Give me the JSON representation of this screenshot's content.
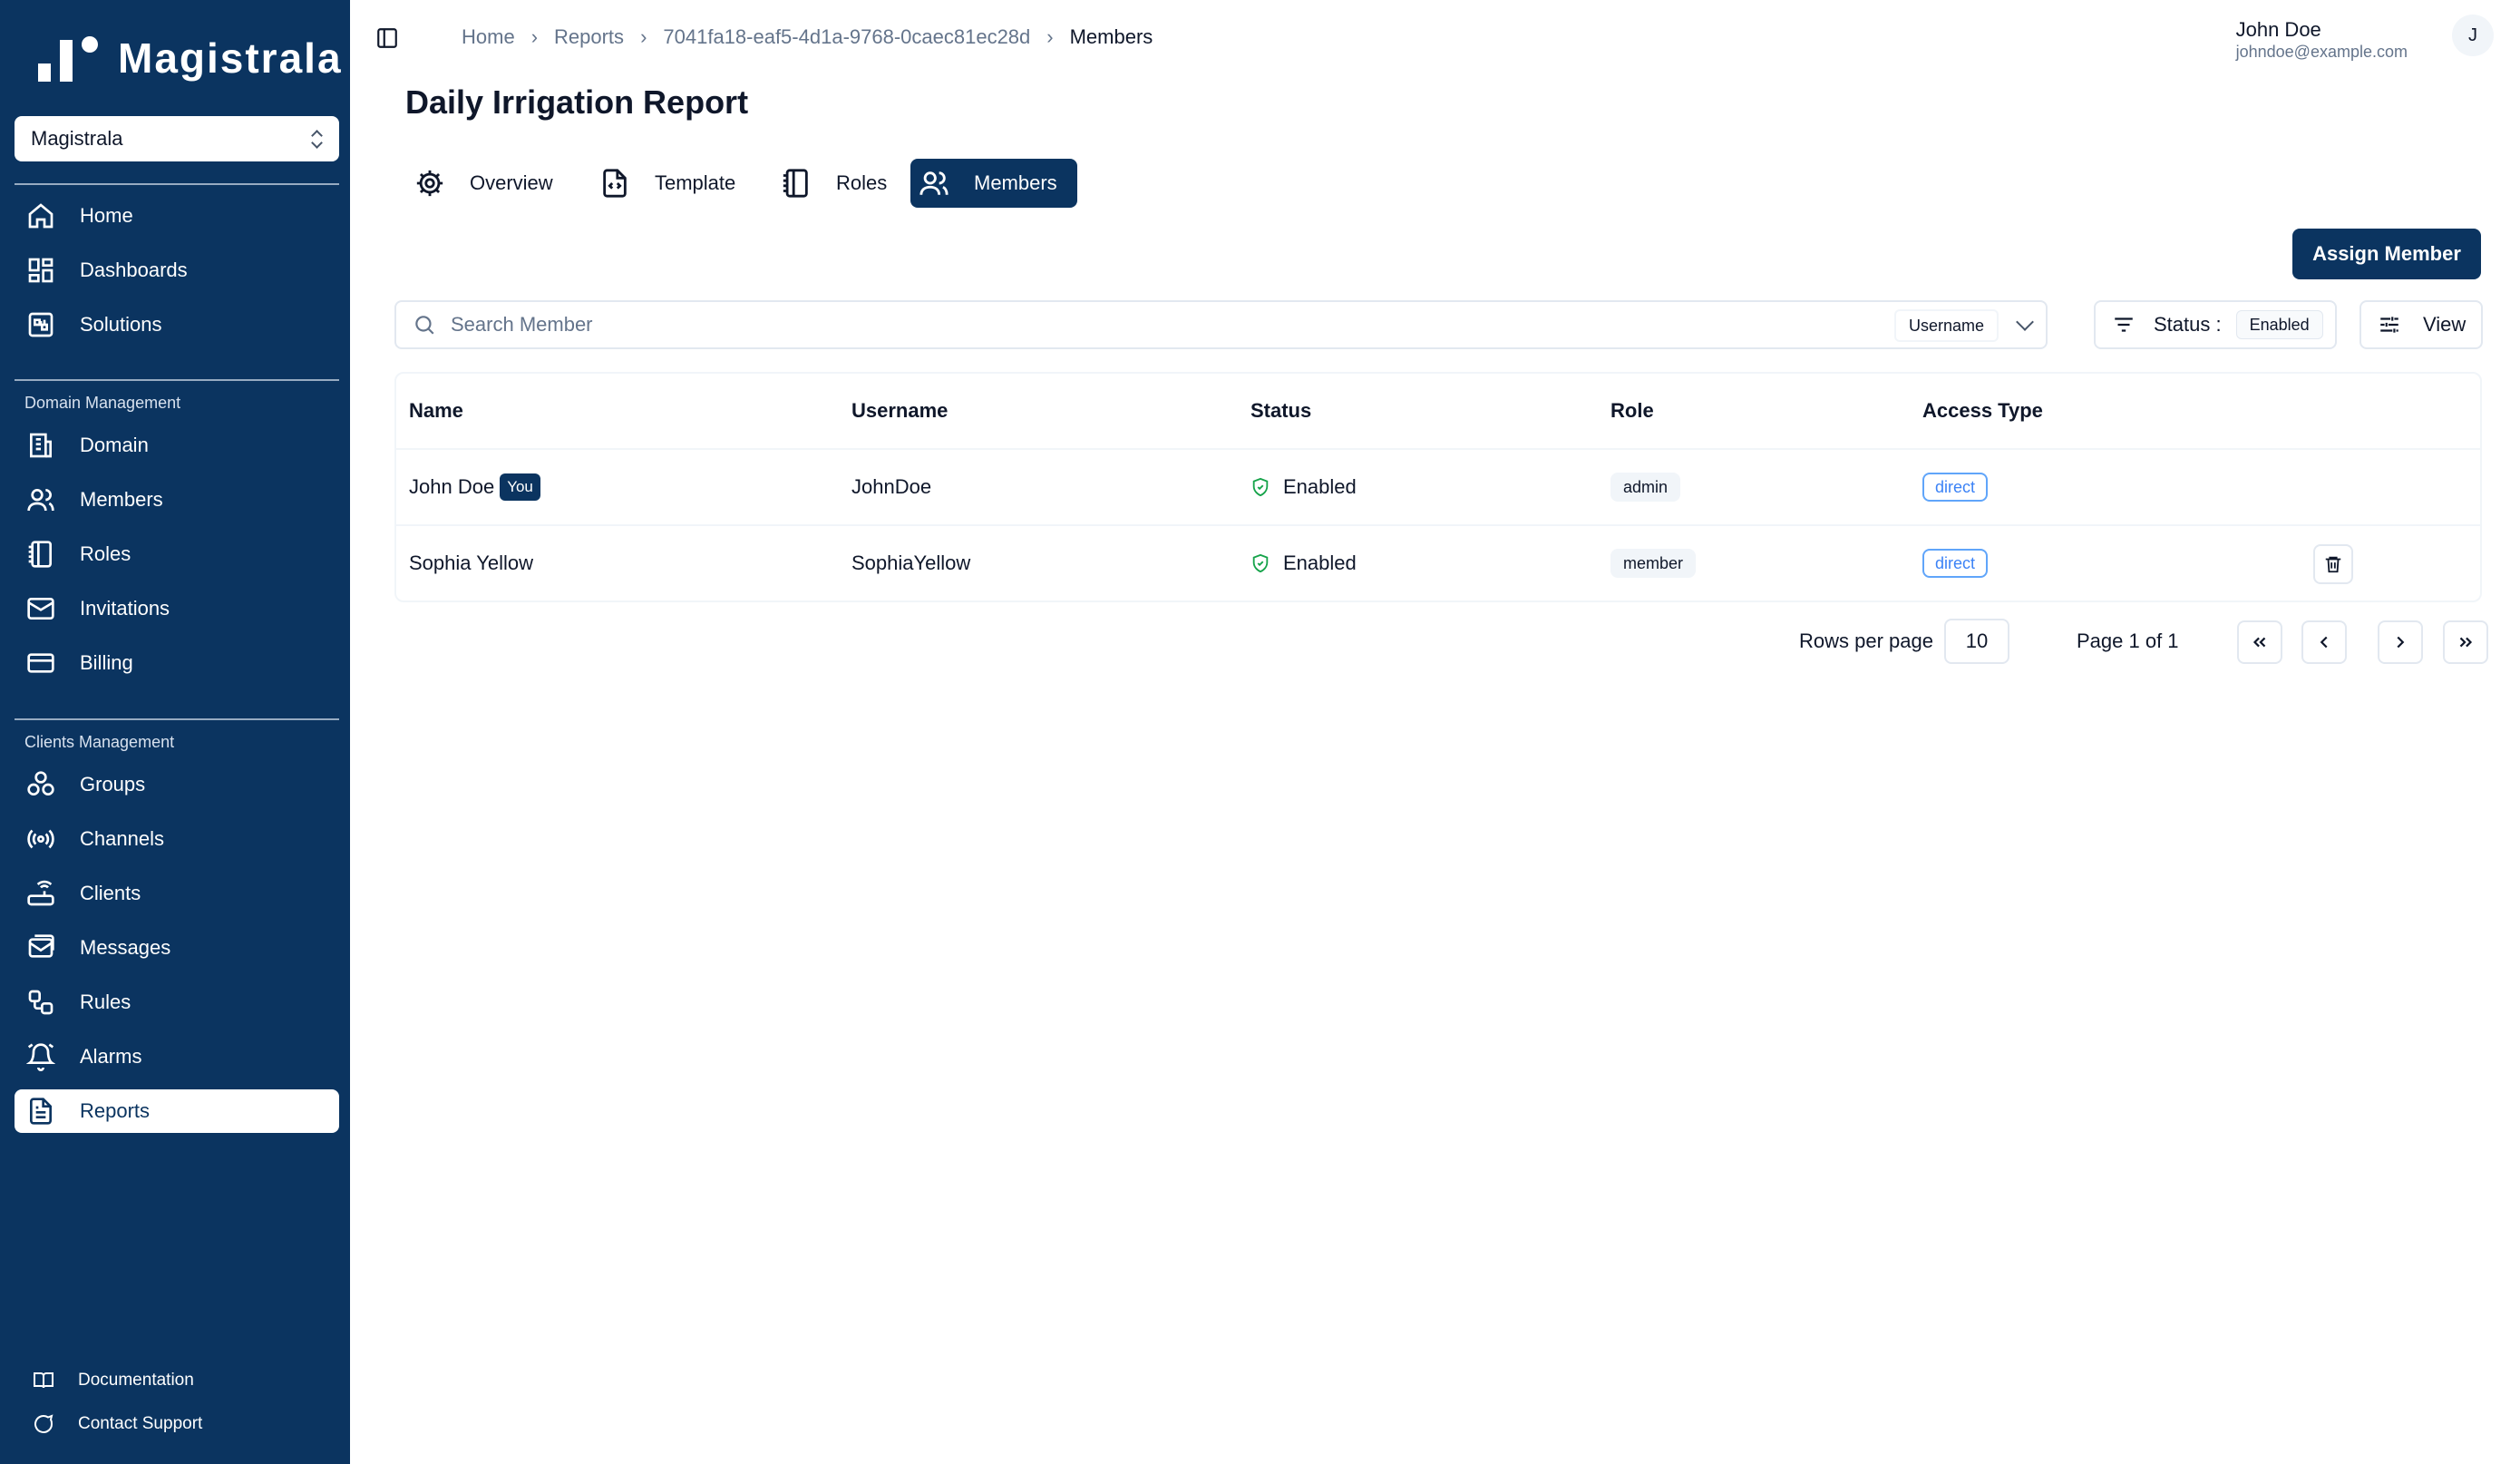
{
  "app": {
    "brand": "Magistrala"
  },
  "workspace": {
    "selected": "Magistrala"
  },
  "sidebar": {
    "main": [
      {
        "label": "Home",
        "icon": "home-icon"
      },
      {
        "label": "Dashboards",
        "icon": "dashboard-icon"
      },
      {
        "label": "Solutions",
        "icon": "solutions-icon"
      }
    ],
    "domain_section": "Domain Management",
    "domain": [
      {
        "label": "Domain",
        "icon": "building-icon"
      },
      {
        "label": "Members",
        "icon": "users-icon"
      },
      {
        "label": "Roles",
        "icon": "notebook-icon"
      },
      {
        "label": "Invitations",
        "icon": "mail-icon"
      },
      {
        "label": "Billing",
        "icon": "credit-card-icon"
      }
    ],
    "clients_section": "Clients Management",
    "clients": [
      {
        "label": "Groups",
        "icon": "groups-icon"
      },
      {
        "label": "Channels",
        "icon": "radio-icon"
      },
      {
        "label": "Clients",
        "icon": "router-icon"
      },
      {
        "label": "Messages",
        "icon": "messages-icon"
      },
      {
        "label": "Rules",
        "icon": "workflow-icon"
      },
      {
        "label": "Alarms",
        "icon": "bell-icon"
      },
      {
        "label": "Reports",
        "icon": "file-text-icon"
      }
    ],
    "footer": [
      {
        "label": "Documentation",
        "icon": "book-icon"
      },
      {
        "label": "Contact Support",
        "icon": "chat-icon"
      }
    ]
  },
  "breadcrumb": [
    "Home",
    "Reports",
    "7041fa18-eaf5-4d1a-9768-0caec81ec28d",
    "Members"
  ],
  "user": {
    "name": "John Doe",
    "email": "johndoe@example.com",
    "initial": "J"
  },
  "page": {
    "title": "Daily Irrigation Report"
  },
  "tabs": [
    {
      "label": "Overview",
      "icon": "gear-icon"
    },
    {
      "label": "Template",
      "icon": "file-code-icon"
    },
    {
      "label": "Roles",
      "icon": "notebook-icon"
    },
    {
      "label": "Members",
      "icon": "users-icon"
    }
  ],
  "actions": {
    "assign": "Assign Member"
  },
  "search": {
    "placeholder": "Search Member",
    "field": "Username"
  },
  "filter": {
    "label": "Status :",
    "value": "Enabled"
  },
  "view": {
    "label": "View"
  },
  "table": {
    "headers": [
      "Name",
      "Username",
      "Status",
      "Role",
      "Access Type"
    ],
    "rows": [
      {
        "name": "John Doe",
        "badge": "You",
        "username": "JohnDoe",
        "status": "Enabled",
        "role": "admin",
        "access": "direct"
      },
      {
        "name": "Sophia Yellow",
        "username": "SophiaYellow",
        "status": "Enabled",
        "role": "member",
        "access": "direct"
      }
    ]
  },
  "pagination": {
    "rows_label": "Rows per page",
    "rows_value": "10",
    "page_info": "Page 1 of 1"
  },
  "colors": {
    "sidebar": "#0b3460",
    "accent": "#0b3460",
    "enabled": "#16a34a",
    "access": "#3b82f6"
  }
}
